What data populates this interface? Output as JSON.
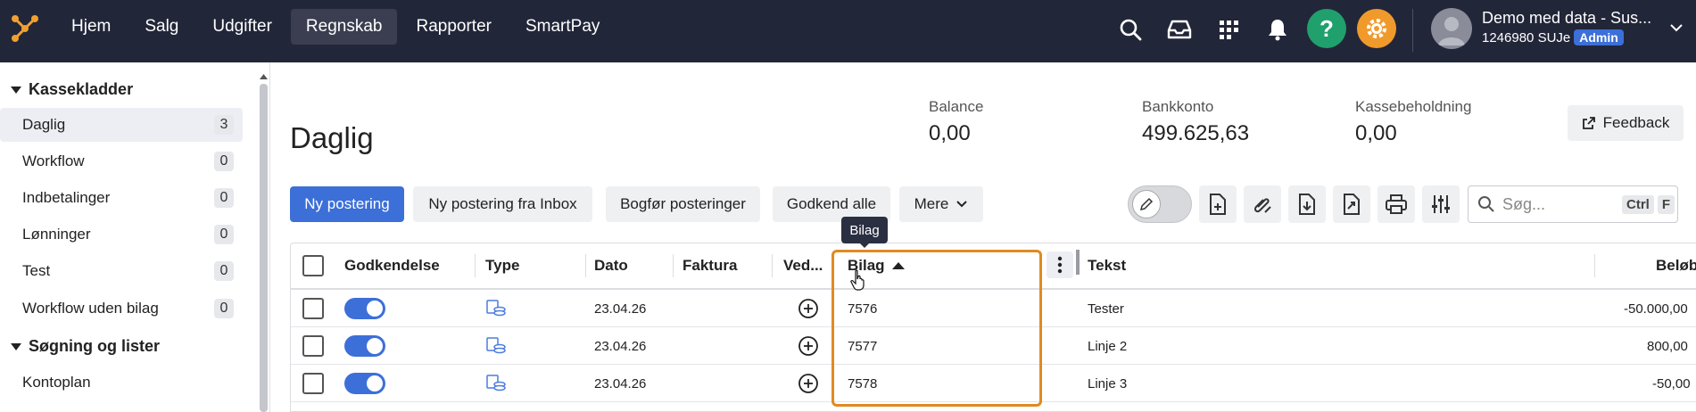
{
  "nav": {
    "items": [
      {
        "label": "Hjem",
        "active": false
      },
      {
        "label": "Salg",
        "active": false
      },
      {
        "label": "Udgifter",
        "active": false
      },
      {
        "label": "Regnskab",
        "active": true
      },
      {
        "label": "Rapporter",
        "active": false
      },
      {
        "label": "SmartPay",
        "active": false
      }
    ],
    "icons": [
      "search-icon",
      "inbox-icon",
      "apps-grid-icon",
      "bell-icon",
      "help-icon",
      "settings-gear-icon"
    ],
    "help_color": "#1fa06c",
    "settings_color": "#f09a2c"
  },
  "user": {
    "name": "Demo med data - Sus...",
    "company": "1246980 SUJe",
    "role_badge": "Admin"
  },
  "sidebar": {
    "section1": "Kassekladder",
    "items": [
      {
        "label": "Daglig",
        "count": "3",
        "active": true
      },
      {
        "label": "Workflow",
        "count": "0"
      },
      {
        "label": "Indbetalinger",
        "count": "0"
      },
      {
        "label": "Lønninger",
        "count": "0"
      },
      {
        "label": "Test",
        "count": "0"
      },
      {
        "label": "Workflow uden bilag",
        "count": "0"
      }
    ],
    "section2": "Søgning og lister",
    "items2": [
      {
        "label": "Kontoplan"
      }
    ]
  },
  "main": {
    "title": "Daglig",
    "stats": [
      {
        "label": "Balance",
        "value": "0,00"
      },
      {
        "label": "Bankkonto",
        "value": "499.625,63"
      },
      {
        "label": "Kassebeholdning",
        "value": "0,00"
      }
    ],
    "feedback_label": "Feedback"
  },
  "toolbar": {
    "new_entry": "Ny postering",
    "new_from_inbox": "Ny postering fra Inbox",
    "post_entries": "Bogfør posteringer",
    "approve_all": "Godkend alle",
    "more": "Mere",
    "search_placeholder": "Søg...",
    "shortcut_ctrl": "Ctrl",
    "shortcut_key": "F"
  },
  "tooltip": "Bilag",
  "table": {
    "headers": {
      "approval": "Godkendelse",
      "type": "Type",
      "date": "Dato",
      "invoice": "Faktura",
      "attachment": "Ved...",
      "voucher": "Bilag",
      "text": "Tekst",
      "amount": "Beløb"
    },
    "rows": [
      {
        "approved": true,
        "date": "23.04.26",
        "voucher": "7576",
        "text": "Tester",
        "amount": "-50.000,00"
      },
      {
        "approved": true,
        "date": "23.04.26",
        "voucher": "7577",
        "text": "Linje 2",
        "amount": "800,00"
      },
      {
        "approved": true,
        "date": "23.04.26",
        "voucher": "7578",
        "text": "Linje 3",
        "amount": "-50,00"
      }
    ]
  }
}
